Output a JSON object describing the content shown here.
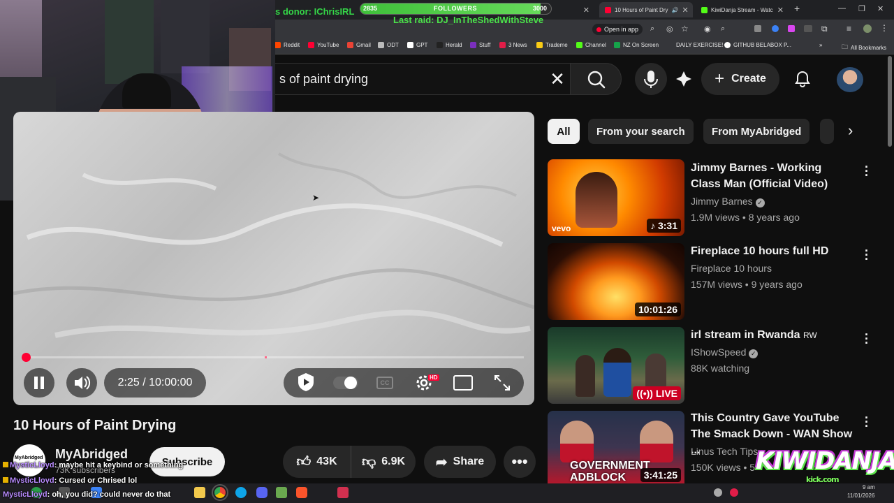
{
  "browser": {
    "tabs": [
      {
        "label": "10 Hours of Paint Dry",
        "active": true
      },
      {
        "label": "KiwiDanja Stream - Watc",
        "active": false
      }
    ],
    "open_in_app": "Open in app",
    "bookmarks": [
      "Reddit",
      "YouTube",
      "Gmail",
      "ODT",
      "GPT",
      "Herald",
      "Stuff",
      "3 News",
      "Trademe",
      "Channel",
      "NZ On Screen",
      "DAILY EXERCISE!",
      "GITHUB BELABOX P..."
    ],
    "all_bookmarks": "All Bookmarks"
  },
  "overlay": {
    "donor": "s donor: IChrisIRL",
    "followers_left": "2835",
    "followers_label": "FOLLOWERS",
    "followers_right": "3000",
    "followers_progress": 0.945,
    "last_raid": "Last raid: DJ_InTheShedWithSteve",
    "logo_line1": "KIWIDANJA",
    "logo_line2": "kick.com"
  },
  "youtube": {
    "search_query": "s of paint drying",
    "create_label": "Create",
    "player": {
      "time": "2:25 / 10:00:00",
      "hd_badge": "HD",
      "progress": 0.0042
    },
    "video_title": "10 Hours of Paint Drying",
    "channel": {
      "name": "MyAbridged",
      "subs": "73K subscribers",
      "avatar_text": "MyAbridged"
    },
    "subscribe_label": "Subscribe",
    "likes": "43K",
    "dislikes": "6.9K",
    "share_label": "Share",
    "chips": [
      "All",
      "From your search",
      "From MyAbridged"
    ],
    "recommendations": [
      {
        "title": "Jimmy Barnes - Working Class Man (Official Video)",
        "channel": "Jimmy Barnes",
        "meta": "1.9M views • 8 years ago",
        "duration": "3:31",
        "verified": true,
        "thumb_tag": "vevo"
      },
      {
        "title": "Fireplace 10 hours full HD",
        "channel": "Fireplace 10 hours",
        "meta": "157M views • 9 years ago",
        "duration": "10:01:26",
        "verified": false
      },
      {
        "title": "irl stream in Rwanda",
        "title_suffix": "RW",
        "channel": "IShowSpeed",
        "meta": "88K watching",
        "duration": "LIVE",
        "verified": true
      },
      {
        "title": "This Country Gave YouTube The Smack Down - WAN Show ...",
        "channel": "Linus Tech Tips",
        "meta": "150K views • 5",
        "duration": "3:41:25",
        "verified": false,
        "thumb_tag": "GOVERNMENT ADBLOCK"
      }
    ]
  },
  "chat": [
    {
      "user": "MysticLloyd",
      "message": "maybe hit a keybind or something"
    },
    {
      "user": "MysticLloyd",
      "message": "Cursed or Chrised lol"
    },
    {
      "user": "MysticLloyd",
      "message": "oh, you did? could never do that"
    }
  ],
  "taskbar": {
    "time": "9 am",
    "date": "11/01/2026"
  },
  "colors": {
    "accent_red": "#ff0033",
    "chat_name": "#b98cff",
    "raid_green": "#4be34a"
  }
}
